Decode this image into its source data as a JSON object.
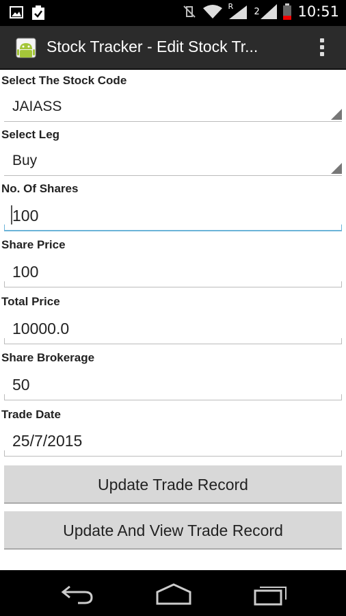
{
  "status": {
    "time": "10:51",
    "signal_label": "R",
    "sim_label": "2"
  },
  "app": {
    "title": "Stock Tracker - Edit Stock Tr...",
    "icon": "android-app-icon"
  },
  "form": {
    "stock_code": {
      "label": "Select The Stock Code",
      "value": "JAIASS"
    },
    "leg": {
      "label": "Select Leg",
      "value": "Buy"
    },
    "shares": {
      "label": "No. Of Shares",
      "value": "100"
    },
    "share_price": {
      "label": "Share Price",
      "value": "100"
    },
    "total_price": {
      "label": "Total Price",
      "value": "10000.0"
    },
    "brokerage": {
      "label": "Share Brokerage",
      "value": "50"
    },
    "trade_date": {
      "label": "Trade Date",
      "value": "25/7/2015"
    }
  },
  "buttons": {
    "update": "Update Trade Record",
    "update_view": "Update And View Trade Record"
  },
  "colors": {
    "accent_focus": "#6bb3d8",
    "action_bar": "#2b2b2b",
    "button_bg": "#d8d8d8"
  }
}
